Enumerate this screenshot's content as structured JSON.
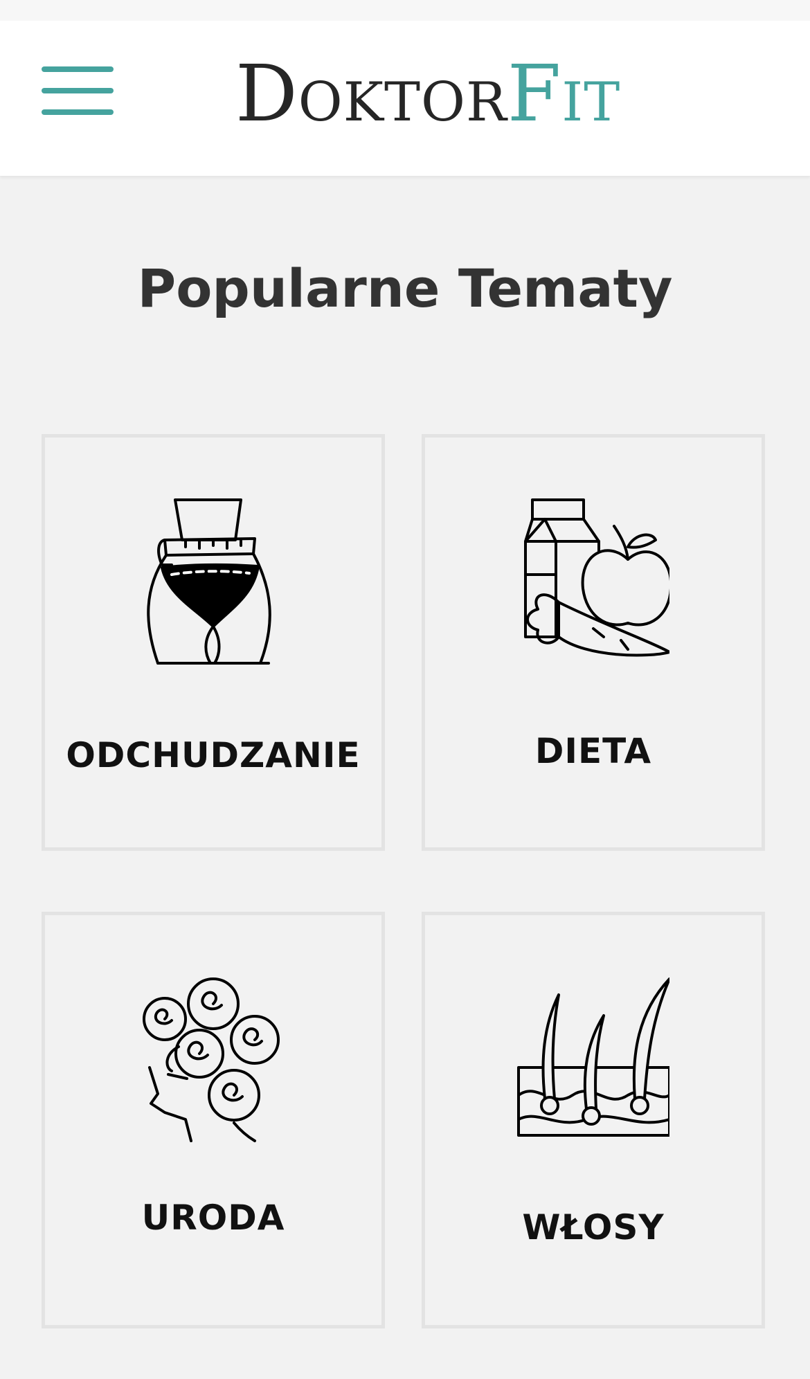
{
  "header": {
    "menu_icon": "hamburger-menu-icon",
    "logo": {
      "part1": "Doktor",
      "part2": "Fit",
      "colors": {
        "dark": "#262626",
        "accent": "#45a39e"
      }
    }
  },
  "main": {
    "title": "Popularne Tematy",
    "topics": [
      {
        "label": "ODCHUDZANIE",
        "icon": "waist-measuring-tape-icon"
      },
      {
        "label": "DIETA",
        "icon": "milk-apple-carrot-icon"
      },
      {
        "label": "URODA",
        "icon": "curly-hair-head-icon"
      },
      {
        "label": "WŁOSY",
        "icon": "hair-follicle-icon"
      }
    ]
  },
  "colors": {
    "background": "#f2f2f2",
    "card_border": "#e3e3e3",
    "accent": "#45a39e"
  }
}
